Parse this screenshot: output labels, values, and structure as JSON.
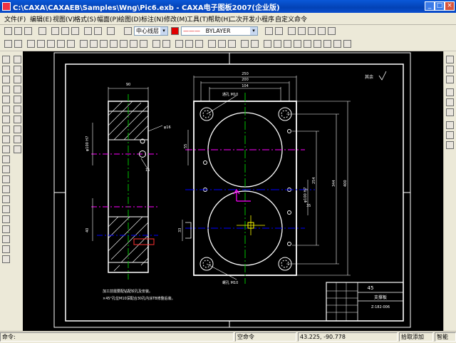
{
  "window": {
    "title": "C:\\CAXA\\CAXAEB\\Samples\\Wng\\Pic6.exb - CAXA电子图板2007(企业版)",
    "minimize_label": "_",
    "maximize_label": "□",
    "close_label": "×"
  },
  "menu": {
    "items": [
      {
        "label": "文件(F)"
      },
      {
        "label": "编辑(E)"
      },
      {
        "label": "视图(V)"
      },
      {
        "label": "格式(S)"
      },
      {
        "label": "幅面(P)"
      },
      {
        "label": "绘图(D)"
      },
      {
        "label": "标注(N)"
      },
      {
        "label": "修改(M)"
      },
      {
        "label": "工具(T)"
      },
      {
        "label": "帮助(H)"
      },
      {
        "label": "二次开发小程序"
      },
      {
        "label": "自定义命令"
      }
    ]
  },
  "toolbar": {
    "layer_combo": "中心线层",
    "linetype_combo": "BYLAYER"
  },
  "drawing": {
    "material": "45",
    "part_name": "支撑板",
    "drawing_no": "Z-182-006",
    "roughness": "其余",
    "notes_line1": "加工前需要配钻配铰孔及安装。",
    "notes_line2": "×45°孔位M10深配合30孔内涂TB修整后装。",
    "dim_top_1": "250",
    "dim_top_2": "200",
    "dim_top_3": "104",
    "dim_left_width": "90",
    "dim_hole_phi": "φ16",
    "dim_right_1": "254",
    "dim_right_2": "344",
    "dim_right_3": "400",
    "dim_vertical": "φ100 H7",
    "dim_small_1": "40",
    "dim_small_2": "15",
    "dim_small_3": "35",
    "dim_small_4": "55",
    "dim_small_5": "33",
    "dim_leader_1": "通孔 M10",
    "dim_leader_2": "螺孔 M10"
  },
  "status": {
    "command_label": "命令:",
    "command_state": "空命令",
    "coordinates": "43.225, -90.778",
    "snap_mode": "拾取添加",
    "intelligent": "智能"
  },
  "colors": {
    "titlebar": "#0a4fd0",
    "canvas": "#000000",
    "draw_white": "#ffffff",
    "center_green": "#00c000",
    "center_blue": "#0000ff",
    "hidden_magenta": "#ff00ff",
    "dim_red": "#ff3030",
    "cursor_yellow": "#ffff00"
  }
}
